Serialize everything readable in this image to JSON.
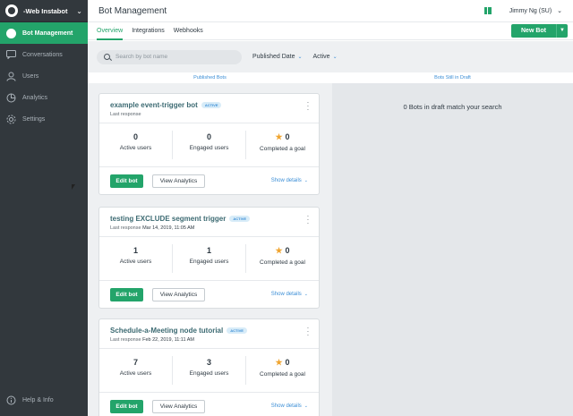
{
  "workspace": {
    "name": "-Web Instabot"
  },
  "sidebar": {
    "items": [
      {
        "label": "Bot Management",
        "icon": "bot-icon",
        "active": true
      },
      {
        "label": "Conversations",
        "icon": "chat-icon",
        "active": false
      },
      {
        "label": "Users",
        "icon": "user-icon",
        "active": false
      },
      {
        "label": "Analytics",
        "icon": "analytics-icon",
        "active": false
      },
      {
        "label": "Settings",
        "icon": "gear-icon",
        "active": false
      }
    ],
    "help_label": "Help & Info"
  },
  "header": {
    "title": "Bot Management",
    "user": "Jimmy Ng (SU)"
  },
  "tabs": [
    {
      "label": "Overview",
      "active": true
    },
    {
      "label": "Integrations",
      "active": false
    },
    {
      "label": "Webhooks",
      "active": false
    }
  ],
  "new_bot_label": "New Bot",
  "filters": {
    "search_placeholder": "Search by bot name",
    "sort": "Published Date",
    "status": "Active"
  },
  "columns": {
    "published": "Published Bots",
    "draft": "Bots Still in Draft",
    "draft_empty": "0 Bots in draft match your search"
  },
  "bots": [
    {
      "name": "example event-trigger bot",
      "status": "ACTIVE",
      "last_label": "Last response",
      "last_value": "",
      "active_users": "0",
      "engaged_users": "0",
      "completed": "0"
    },
    {
      "name": "testing EXCLUDE segment trigger",
      "status": "ACTIVE",
      "last_label": "Last response",
      "last_value": "Mar 14, 2019, 11:05 AM",
      "active_users": "1",
      "engaged_users": "1",
      "completed": "0"
    },
    {
      "name": "Schedule-a-Meeting node tutorial",
      "status": "ACTIVE",
      "last_label": "Last response",
      "last_value": "Feb 22, 2019, 11:11 AM",
      "active_users": "7",
      "engaged_users": "3",
      "completed": "0"
    }
  ],
  "labels": {
    "active_users": "Active users",
    "engaged_users": "Engaged users",
    "completed": "Completed a goal",
    "edit": "Edit bot",
    "analytics": "View Analytics",
    "details": "Show details"
  },
  "colors": {
    "accent": "#23a46a",
    "sidebar": "#32383d",
    "link": "#3b8ed6",
    "star": "#f0a531"
  }
}
